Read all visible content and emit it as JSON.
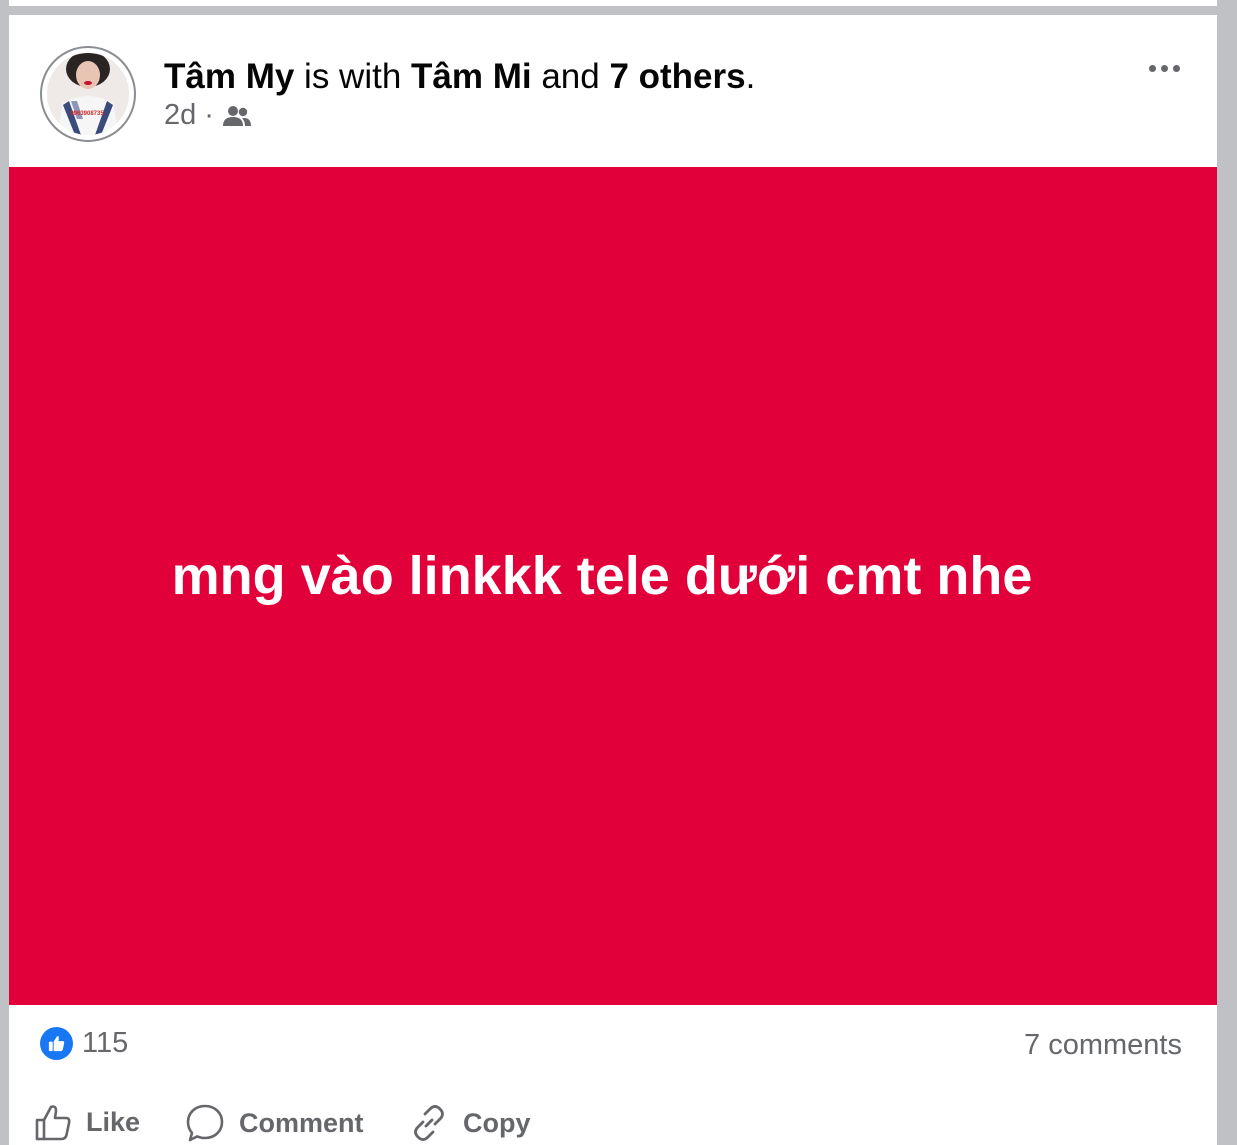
{
  "colors": {
    "post_background": "#e1003a",
    "like_blue": "#1877f2",
    "secondary_text": "#65676b"
  },
  "post": {
    "author": "Tâm My",
    "with_text": " is with ",
    "tagged": "Tâm Mi",
    "and_text": " and ",
    "others": "7 others",
    "period": ".",
    "time": "2d",
    "separator": "·",
    "audience_icon": "friends-icon",
    "avatar_watermark": "0963908735",
    "content_text": "mng vào linkkk tele dưới cmt nhe"
  },
  "stats": {
    "reaction_icon": "like-icon",
    "likes": "115",
    "comments": "7 comments"
  },
  "actions": {
    "like": "Like",
    "comment": "Comment",
    "copy": "Copy"
  }
}
